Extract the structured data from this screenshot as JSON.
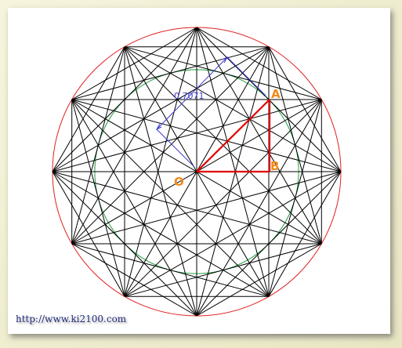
{
  "labels": {
    "point_a": "A",
    "point_b": "B",
    "point_o": "O",
    "dimension": "0.7071"
  },
  "watermark": "http://www.ki2100.com",
  "colors": {
    "outer_circle": "#e02020",
    "inner_circle": "#20a040",
    "star_lines": "#000000",
    "triangle": "#e00000",
    "dimension": "#3a3ad0",
    "point_labels": "#f28a1a"
  },
  "geometry": {
    "polygon_vertices": 12,
    "star_step": 5,
    "radius_ratio": 0.7071
  }
}
